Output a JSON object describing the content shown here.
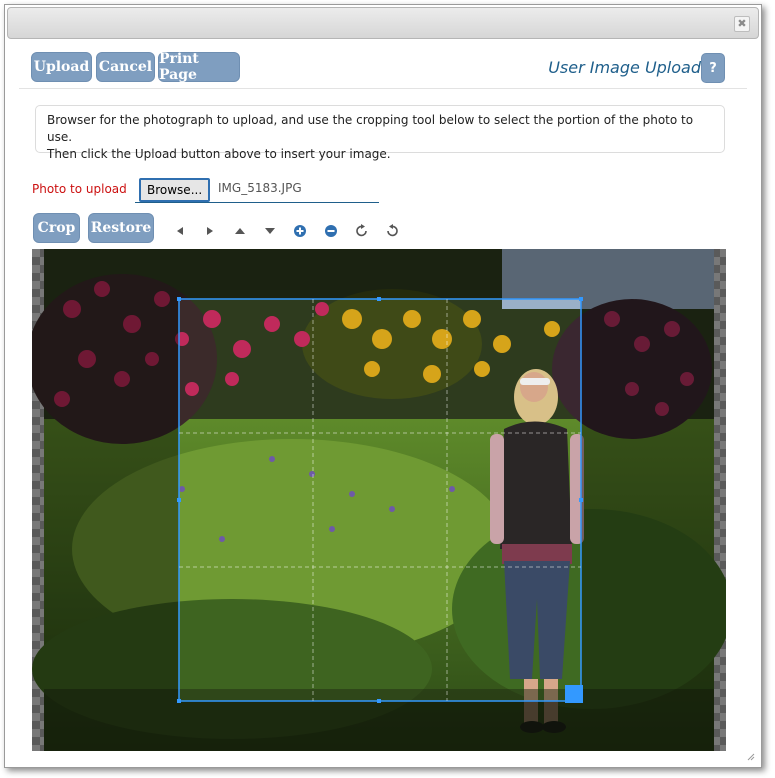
{
  "window": {
    "close_glyph": "✖"
  },
  "toolbar": {
    "upload_label": "Upload",
    "cancel_label": "Cancel",
    "print_label": "Print Page",
    "title": "User Image Upload",
    "help_label": "?"
  },
  "instructions": {
    "line1": "Browser for the photograph to upload, and use the cropping tool below to select the portion of the photo to use.",
    "line2": "Then click the Upload button above to insert your image."
  },
  "file": {
    "label": "Photo to upload",
    "browse_label": "Browse...",
    "filename": "IMG_5183.JPG"
  },
  "crop_tools": {
    "crop_label": "Crop",
    "restore_label": "Restore",
    "icons": [
      "move-left-icon",
      "move-right-icon",
      "move-up-icon",
      "move-down-icon",
      "zoom-in-icon",
      "zoom-out-icon",
      "rotate-right-icon",
      "rotate-left-icon"
    ]
  },
  "colors": {
    "button": "#7f9ec0",
    "title": "#1f5f8b",
    "label_red": "#cc1111",
    "crop_border": "#3399ff"
  }
}
